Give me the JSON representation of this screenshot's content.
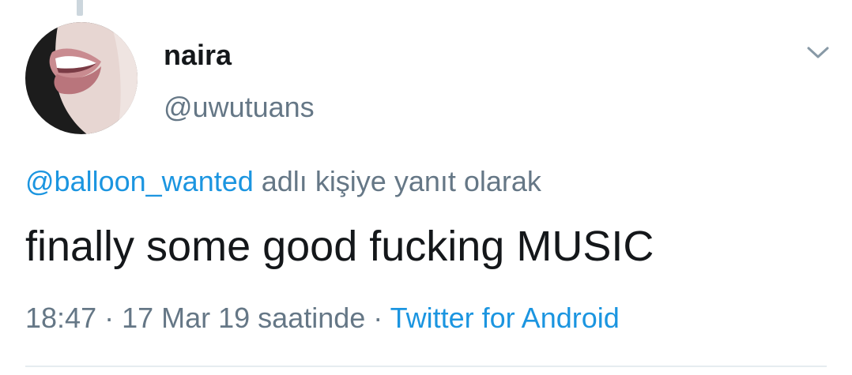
{
  "tweet": {
    "display_name": "naira",
    "handle": "@uwutuans",
    "reply_to_mention": "@balloon_wanted",
    "reply_to_suffix": " adlı kişiye yanıt olarak",
    "text": "finally some good fucking MUSIC",
    "time": "18:47",
    "separator": " · ",
    "date": "17 Mar 19 saatinde",
    "source": "Twitter for Android"
  },
  "icons": {
    "menu": "chevron-down-icon",
    "avatar": "avatar-image"
  },
  "colors": {
    "text_primary": "#14171a",
    "text_secondary": "#657786",
    "link": "#1b95e0",
    "divider": "#e6ecf0"
  }
}
